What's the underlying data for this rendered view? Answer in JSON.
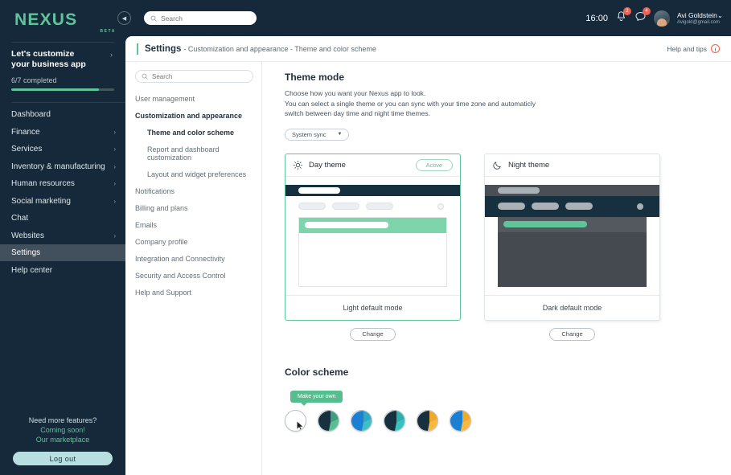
{
  "brand": {
    "name": "NEXUS",
    "tag": "BETA",
    "accent": "#5fc49a"
  },
  "sidebar": {
    "promo": {
      "line1": "Let's customize",
      "line2": "your business app",
      "progress_label": "6/7 completed",
      "progress_pct": 85
    },
    "items": [
      {
        "label": "Dashboard",
        "chevron": false,
        "active": false
      },
      {
        "label": "Finance",
        "chevron": true,
        "active": false
      },
      {
        "label": "Services",
        "chevron": true,
        "active": false
      },
      {
        "label": "Inventory & manufacturing",
        "chevron": true,
        "active": false
      },
      {
        "label": "Human resources",
        "chevron": true,
        "active": false
      },
      {
        "label": "Social marketing",
        "chevron": true,
        "active": false
      },
      {
        "label": "Chat",
        "chevron": false,
        "active": false
      },
      {
        "label": "Websites",
        "chevron": true,
        "active": false
      },
      {
        "label": "Settings",
        "chevron": false,
        "active": true
      },
      {
        "label": "Help center",
        "chevron": false,
        "active": false
      }
    ],
    "footer": {
      "need": "Need more features?",
      "coming": "Coming soon!",
      "marketplace": "Our marketplace",
      "logout": "Log out"
    }
  },
  "topbar": {
    "search_placeholder": "Search",
    "clock": "16:00",
    "bell_badge": "2",
    "chat_badge": "4",
    "user_name": "Avi Goldstein",
    "user_email": "Avigold@gmail.com"
  },
  "page": {
    "title": "Settings",
    "breadcrumb": "- Customization and appearance - Theme and color scheme",
    "help_tips": "Help and tips"
  },
  "submenu": {
    "search_placeholder": "Search",
    "items": [
      {
        "label": "User management",
        "level": 0,
        "selected": false
      },
      {
        "label": "Customization and appearance",
        "level": 0,
        "selected": true
      },
      {
        "label": "Theme and color scheme",
        "level": 1,
        "selected": true
      },
      {
        "label": "Report and dashboard customization",
        "level": 1,
        "selected": false
      },
      {
        "label": "Layout and widget preferences",
        "level": 1,
        "selected": false
      },
      {
        "label": "Notifications",
        "level": 0,
        "selected": false
      },
      {
        "label": "Billing and plans",
        "level": 0,
        "selected": false
      },
      {
        "label": "Emails",
        "level": 0,
        "selected": false
      },
      {
        "label": "Company profile",
        "level": 0,
        "selected": false
      },
      {
        "label": "Integration and Connectivity",
        "level": 0,
        "selected": false
      },
      {
        "label": "Security and Access Control",
        "level": 0,
        "selected": false
      },
      {
        "label": "Help and Support",
        "level": 0,
        "selected": false
      }
    ]
  },
  "theme_mode": {
    "heading": "Theme mode",
    "desc_line1": "Choose how you want your Nexus app to look.",
    "desc_line2": "You can select a single theme or you can sync with your time zone and automaticly",
    "desc_line3": "switch between day time and night time themes.",
    "sync_value": "System sync",
    "day": {
      "name": "Day theme",
      "badge": "Active",
      "footer": "Light default mode",
      "change": "Change"
    },
    "night": {
      "name": "Night theme",
      "badge": "",
      "footer": "Dark default mode",
      "change": "Change"
    }
  },
  "color_scheme": {
    "heading": "Color scheme",
    "tooltip": "Make your own",
    "swatches": [
      {
        "name": "make-your-own",
        "colors": [
          "#ffffff",
          "#ffffff",
          "#ffffff"
        ]
      },
      {
        "name": "dark-green",
        "colors": [
          "#18313f",
          "#58bf93",
          "#3f9f7c"
        ]
      },
      {
        "name": "blue-teal",
        "colors": [
          "#1b7fd4",
          "#3dc0c2",
          "#2fa9c6"
        ]
      },
      {
        "name": "navy-teal",
        "colors": [
          "#17303e",
          "#34c3bf",
          "#2bb0ae"
        ]
      },
      {
        "name": "navy-amber",
        "colors": [
          "#16303e",
          "#f6b93b",
          "#f0a92a"
        ]
      },
      {
        "name": "blue-amber",
        "colors": [
          "#1b7fd4",
          "#f6b93b",
          "#f0a92a"
        ]
      }
    ]
  }
}
